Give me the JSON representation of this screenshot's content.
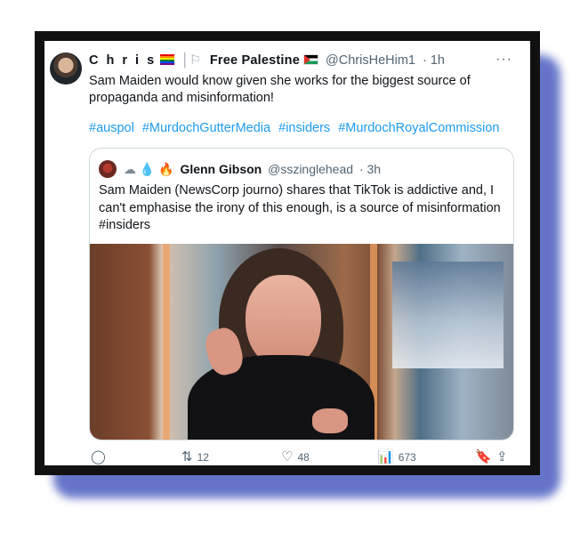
{
  "tweet": {
    "author_name": "C h r i s",
    "tagline": "Free Palestine",
    "handle": "@ChrisHeHim1",
    "time": "· 1h",
    "more_icon": "···",
    "text": "Sam Maiden would know given she works for the biggest source of propaganda and misinformation!",
    "hashtags": [
      "#auspol",
      "#MurdochGutterMedia",
      "#insiders",
      "#MurdochRoyalCommission"
    ]
  },
  "quote": {
    "emojis": [
      "cloud-icon",
      "droplet-icon",
      "fire-icon"
    ],
    "author_name": "Glenn Gibson",
    "handle": "@sszinglehead",
    "time": "· 3h",
    "text": "Sam Maiden (NewsCorp journo) shares that TikTok is addictive and, I can't emphasise the irony of this enough, is a source of misinformation #insiders"
  },
  "actions": {
    "replies": "",
    "retweets": "12",
    "likes": "48",
    "views": "673"
  }
}
